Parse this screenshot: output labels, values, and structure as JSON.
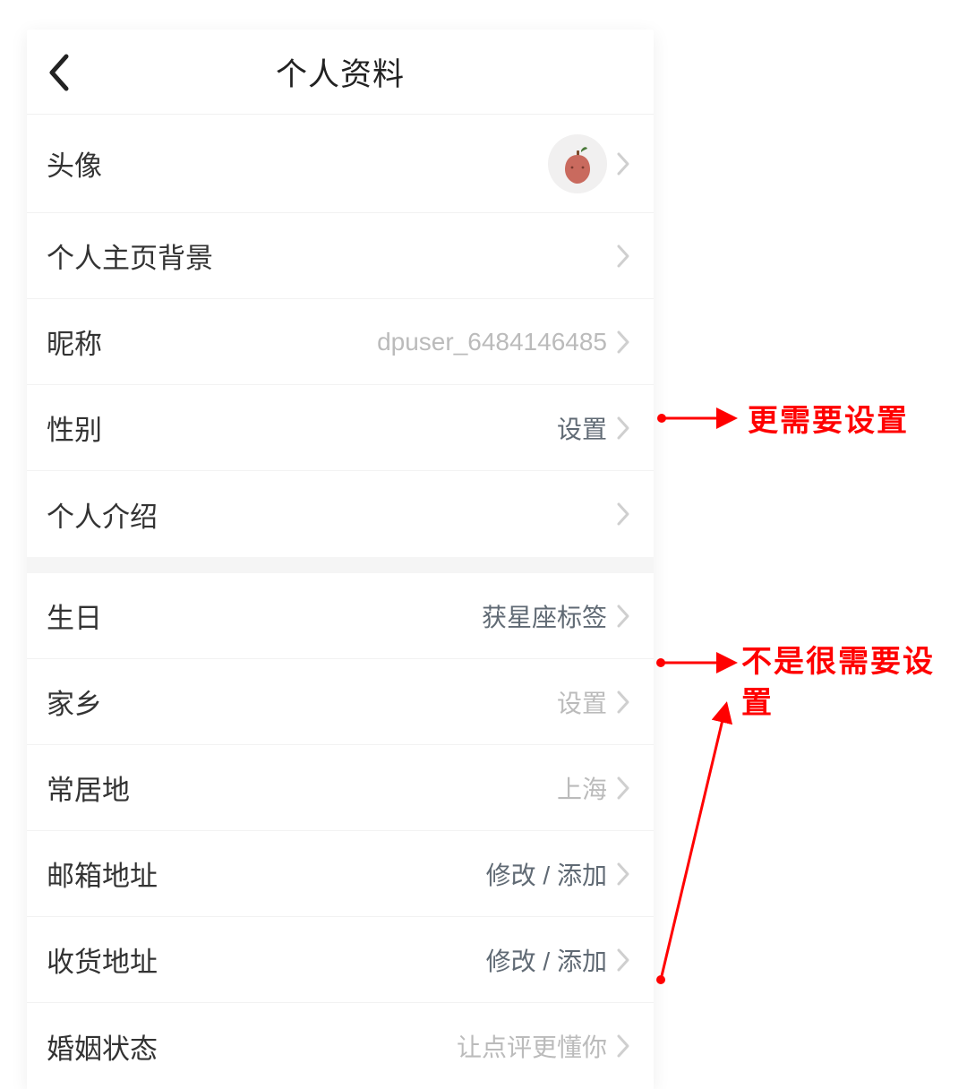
{
  "header": {
    "title": "个人资料"
  },
  "group1": {
    "avatar": {
      "label": "头像"
    },
    "background": {
      "label": "个人主页背景"
    },
    "nickname": {
      "label": "昵称",
      "value": "dpuser_6484146485"
    },
    "gender": {
      "label": "性别",
      "value": "设置"
    },
    "intro": {
      "label": "个人介绍"
    }
  },
  "group2": {
    "birthday": {
      "label": "生日",
      "value": "获星座标签"
    },
    "hometown": {
      "label": "家乡",
      "value": "设置"
    },
    "residence": {
      "label": "常居地",
      "value": "上海"
    },
    "email": {
      "label": "邮箱地址",
      "value": "修改 / 添加"
    },
    "address": {
      "label": "收货地址",
      "value": "修改 / 添加"
    },
    "marital": {
      "label": "婚姻状态",
      "value": "让点评更懂你"
    }
  },
  "annotations": {
    "a1": "更需要设置",
    "a2": "不是很需要设置"
  }
}
